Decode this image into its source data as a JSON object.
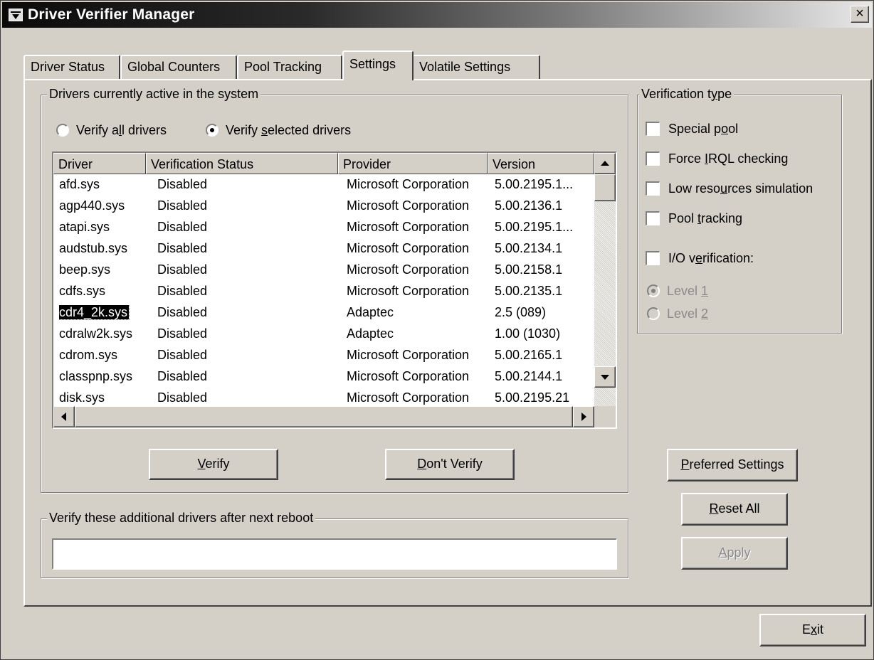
{
  "window": {
    "title": "Driver Verifier Manager",
    "close_glyph": "×"
  },
  "tabs": [
    {
      "label": "Driver Status",
      "active": false
    },
    {
      "label": "Global Counters",
      "active": false
    },
    {
      "label": "Pool Tracking",
      "active": false
    },
    {
      "label": "Settings",
      "active": true
    },
    {
      "label": "Volatile Settings",
      "active": false
    }
  ],
  "drivers_group": {
    "legend": "Drivers currently active in the system",
    "radio_all": {
      "label_pre": "Verify a",
      "label_ul": "l",
      "label_post": "l drivers",
      "selected": false
    },
    "radio_selected": {
      "label_pre": "Verify ",
      "label_ul": "s",
      "label_post": "elected drivers",
      "selected": true
    },
    "columns": [
      "Driver",
      "Verification Status",
      "Provider",
      "Version"
    ],
    "rows": [
      {
        "driver": "afd.sys",
        "status": "Disabled",
        "provider": "Microsoft Corporation",
        "version": "5.00.2195.1..."
      },
      {
        "driver": "agp440.sys",
        "status": "Disabled",
        "provider": "Microsoft Corporation",
        "version": "5.00.2136.1"
      },
      {
        "driver": "atapi.sys",
        "status": "Disabled",
        "provider": "Microsoft Corporation",
        "version": "5.00.2195.1..."
      },
      {
        "driver": "audstub.sys",
        "status": "Disabled",
        "provider": "Microsoft Corporation",
        "version": "5.00.2134.1"
      },
      {
        "driver": "beep.sys",
        "status": "Disabled",
        "provider": "Microsoft Corporation",
        "version": "5.00.2158.1"
      },
      {
        "driver": "cdfs.sys",
        "status": "Disabled",
        "provider": "Microsoft Corporation",
        "version": "5.00.2135.1"
      },
      {
        "driver": "cdr4_2k.sys",
        "status": "Disabled",
        "provider": "Adaptec",
        "version": "2.5 (089)",
        "selected": true
      },
      {
        "driver": "cdralw2k.sys",
        "status": "Disabled",
        "provider": "Adaptec",
        "version": "1.00 (1030)"
      },
      {
        "driver": "cdrom.sys",
        "status": "Disabled",
        "provider": "Microsoft Corporation",
        "version": "5.00.2165.1"
      },
      {
        "driver": "classpnp.sys",
        "status": "Disabled",
        "provider": "Microsoft Corporation",
        "version": "5.00.2144.1"
      },
      {
        "driver": "disk.sys",
        "status": "Disabled",
        "provider": "Microsoft Corporation",
        "version": "5.00.2195.21"
      }
    ],
    "verify_button": {
      "ul": "V",
      "rest": "erify"
    },
    "dont_verify_button": {
      "ul": "D",
      "rest": "on't Verify"
    }
  },
  "verification_type": {
    "legend_pre": "Verification t",
    "legend_ul": "y",
    "legend_post": "pe",
    "options": [
      {
        "pre": "Special p",
        "ul": "o",
        "post": "ol",
        "checked": false
      },
      {
        "pre": "Force ",
        "ul": "I",
        "post": "RQL checking",
        "checked": false
      },
      {
        "pre": "Low reso",
        "ul": "u",
        "post": "rces simulation",
        "checked": false
      },
      {
        "pre": "Pool ",
        "ul": "t",
        "post": "racking",
        "checked": false
      },
      {
        "pre": "I/O v",
        "ul": "e",
        "post": "rification:",
        "checked": false
      }
    ],
    "level1": {
      "pre": "Level ",
      "ul": "1",
      "selected": true,
      "disabled": true
    },
    "level2": {
      "pre": "Level ",
      "ul": "2",
      "selected": false,
      "disabled": true
    }
  },
  "buttons": {
    "preferred": {
      "ul": "P",
      "rest": "referred Settings"
    },
    "reset": {
      "ul": "R",
      "rest": "eset All"
    },
    "apply": {
      "ul": "A",
      "rest": "pply",
      "disabled": true
    },
    "exit": {
      "pre": "E",
      "ul": "x",
      "post": "it"
    }
  },
  "additional_group": {
    "legend": "Verify these additional drivers after next reboot",
    "value": ""
  }
}
